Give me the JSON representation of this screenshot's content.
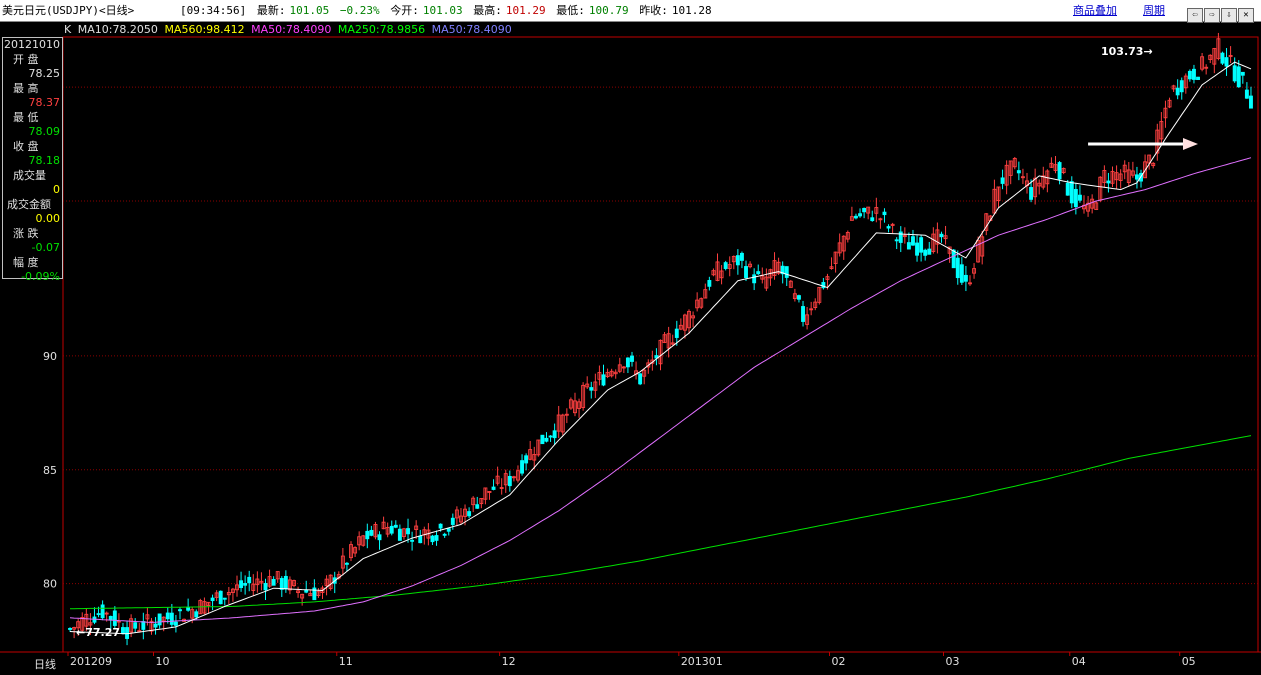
{
  "window": {
    "title": "美元日元(USDJPY)<日线>",
    "time": "[09:34:56]",
    "latest_label": "最新:",
    "latest_value": "101.05",
    "change_pct": "−0.23%",
    "open_label": "今开:",
    "open_value": "101.03",
    "high_label": "最高:",
    "high_value": "101.29",
    "low_label": "最低:",
    "low_value": "100.79",
    "prevclose_label": "昨收:",
    "prevclose_value": "101.28",
    "link_overlay": "商品叠加",
    "link_period": "周期",
    "window_buttons": [
      "⇦",
      "⇨",
      "⇩",
      "✕"
    ]
  },
  "legend": {
    "k": "K",
    "ma10": "MA10:78.2050",
    "ma560": "MA560:98.412",
    "ma50a": "MA50:78.4090",
    "ma250": "MA250:78.9856",
    "ma50b": "MA50:78.4090"
  },
  "infobox": {
    "date": "20121010",
    "open_label": "开  盘",
    "open": "78.25",
    "high_label": "最  高",
    "high": "78.37",
    "low_label": "最  低",
    "low": "78.09",
    "close_label": "收  盘",
    "close": "78.18",
    "volume_label": "成交量",
    "volume": "0",
    "amount_label": "成交金额",
    "amount": "0.00",
    "change_label": "涨  跌",
    "change": "-0.07",
    "range_label": "幅  度",
    "range": "-0.09%"
  },
  "bottom_label": "日线",
  "colors": {
    "up": "#ff4040",
    "down": "#00ffff",
    "ma_short": "#ffffff",
    "ma_mid": "#e070ff",
    "ma_long": "#00e000",
    "grid": "#8b0000",
    "axis": "#c00000"
  },
  "chart_data": {
    "type": "candlestick",
    "ylim": [
      77,
      104
    ],
    "y_ticks": [
      80,
      85,
      90
    ],
    "x_tick_labels": [
      "201209",
      "10",
      "11",
      "12",
      "201301",
      "02",
      "03",
      "04",
      "05"
    ],
    "annotations": {
      "max_label": "103.73",
      "min_label": "77.27",
      "resistance_level": 99.3
    },
    "anchor_closes": [
      [
        0,
        78.0
      ],
      [
        4,
        78.5
      ],
      [
        8,
        78.8
      ],
      [
        14,
        78.0
      ],
      [
        20,
        78.3
      ],
      [
        26,
        78.6
      ],
      [
        32,
        79.0
      ],
      [
        38,
        79.6
      ],
      [
        44,
        80.0
      ],
      [
        50,
        80.2
      ],
      [
        56,
        79.7
      ],
      [
        62,
        79.6
      ],
      [
        66,
        80.6
      ],
      [
        72,
        82.0
      ],
      [
        78,
        82.5
      ],
      [
        84,
        82.2
      ],
      [
        90,
        82.3
      ],
      [
        96,
        83.0
      ],
      [
        102,
        84.0
      ],
      [
        108,
        84.6
      ],
      [
        114,
        86.0
      ],
      [
        120,
        87.0
      ],
      [
        126,
        88.3
      ],
      [
        132,
        89.3
      ],
      [
        136,
        89.9
      ],
      [
        140,
        89.0
      ],
      [
        146,
        90.5
      ],
      [
        152,
        91.8
      ],
      [
        158,
        93.6
      ],
      [
        164,
        94.2
      ],
      [
        170,
        93.2
      ],
      [
        174,
        94.0
      ],
      [
        180,
        91.7
      ],
      [
        186,
        93.5
      ],
      [
        192,
        96.1
      ],
      [
        198,
        96.3
      ],
      [
        204,
        95.0
      ],
      [
        210,
        94.8
      ],
      [
        214,
        95.2
      ],
      [
        220,
        93.0
      ],
      [
        224,
        95.3
      ],
      [
        228,
        97.6
      ],
      [
        232,
        98.3
      ],
      [
        236,
        97.2
      ],
      [
        242,
        98.6
      ],
      [
        246,
        97.0
      ],
      [
        250,
        96.3
      ],
      [
        254,
        97.9
      ],
      [
        258,
        98.0
      ],
      [
        262,
        97.8
      ],
      [
        266,
        98.8
      ],
      [
        270,
        101.5
      ],
      [
        274,
        102.2
      ],
      [
        278,
        102.7
      ],
      [
        282,
        103.5
      ],
      [
        286,
        102.5
      ],
      [
        290,
        101.3
      ]
    ],
    "ma_short_anchors": [
      [
        0,
        77.9
      ],
      [
        14,
        77.8
      ],
      [
        26,
        78.1
      ],
      [
        38,
        79.0
      ],
      [
        50,
        79.8
      ],
      [
        62,
        79.7
      ],
      [
        72,
        81.1
      ],
      [
        84,
        82.0
      ],
      [
        96,
        82.6
      ],
      [
        108,
        83.9
      ],
      [
        120,
        86.3
      ],
      [
        132,
        88.5
      ],
      [
        140,
        89.3
      ],
      [
        152,
        91.0
      ],
      [
        164,
        93.3
      ],
      [
        174,
        93.7
      ],
      [
        186,
        93.0
      ],
      [
        198,
        95.4
      ],
      [
        210,
        95.3
      ],
      [
        220,
        94.3
      ],
      [
        228,
        96.5
      ],
      [
        238,
        97.9
      ],
      [
        246,
        97.6
      ],
      [
        258,
        97.3
      ],
      [
        262,
        97.6
      ],
      [
        270,
        99.8
      ],
      [
        278,
        101.9
      ],
      [
        286,
        102.9
      ],
      [
        290,
        102.6
      ]
    ],
    "ma_mid_anchors": [
      [
        0,
        78.5
      ],
      [
        20,
        78.3
      ],
      [
        40,
        78.5
      ],
      [
        60,
        78.8
      ],
      [
        72,
        79.2
      ],
      [
        84,
        79.9
      ],
      [
        96,
        80.8
      ],
      [
        108,
        81.9
      ],
      [
        120,
        83.2
      ],
      [
        132,
        84.7
      ],
      [
        144,
        86.3
      ],
      [
        156,
        87.9
      ],
      [
        168,
        89.5
      ],
      [
        180,
        90.8
      ],
      [
        192,
        92.1
      ],
      [
        204,
        93.3
      ],
      [
        216,
        94.3
      ],
      [
        228,
        95.3
      ],
      [
        240,
        96.0
      ],
      [
        252,
        96.8
      ],
      [
        264,
        97.3
      ],
      [
        276,
        98.0
      ],
      [
        290,
        98.7
      ]
    ],
    "ma_long_anchors": [
      [
        0,
        78.9
      ],
      [
        40,
        79.0
      ],
      [
        60,
        79.2
      ],
      [
        80,
        79.5
      ],
      [
        100,
        79.9
      ],
      [
        120,
        80.4
      ],
      [
        140,
        81.0
      ],
      [
        160,
        81.7
      ],
      [
        180,
        82.4
      ],
      [
        200,
        83.1
      ],
      [
        220,
        83.8
      ],
      [
        240,
        84.6
      ],
      [
        260,
        85.5
      ],
      [
        275,
        86.0
      ],
      [
        290,
        86.5
      ]
    ]
  }
}
